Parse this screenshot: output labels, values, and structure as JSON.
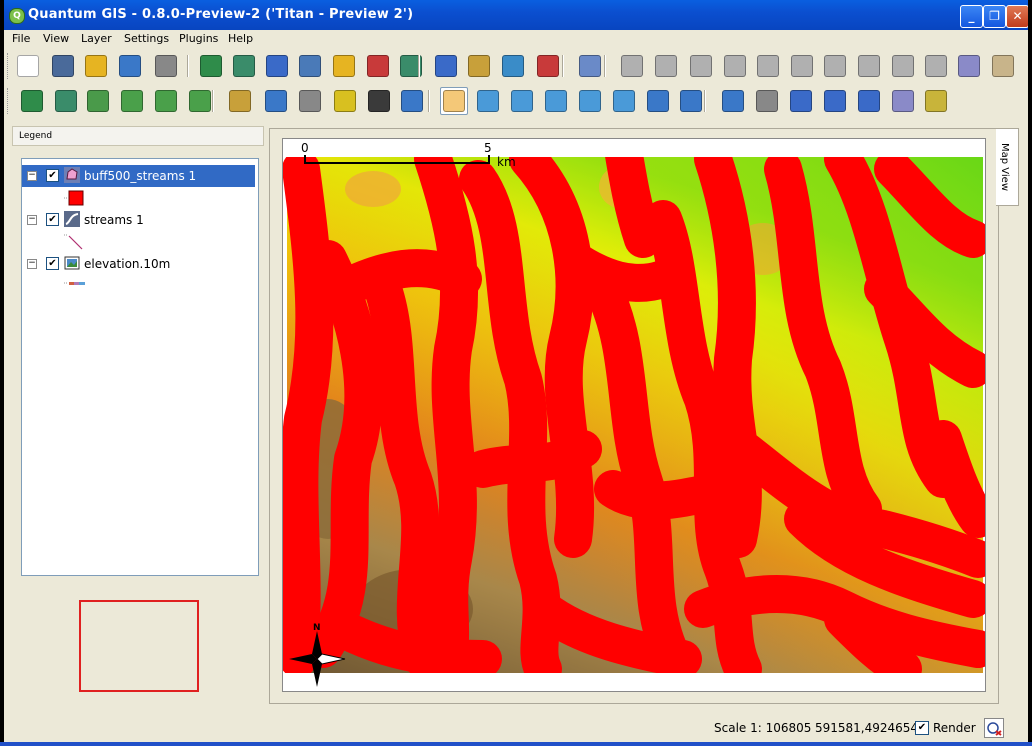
{
  "window": {
    "title": "Quantum GIS - 0.8.0-Preview-2 ('Titan - Preview 2')",
    "buttons": [
      "_",
      "❐",
      "✕"
    ]
  },
  "menu": [
    "File",
    "View",
    "Layer",
    "Settings",
    "Plugins",
    "Help"
  ],
  "toolbar1": {
    "tools": [
      {
        "name": "new-project-icon",
        "color": "#ffffff"
      },
      {
        "name": "save-project-icon",
        "color": "#4a6a9a"
      },
      {
        "name": "save-as-icon",
        "color": "#e6b422"
      },
      {
        "name": "open-project-icon",
        "color": "#3a78c8"
      },
      {
        "name": "print-icon",
        "color": "#888888"
      },
      {
        "name": "add-raster-icon",
        "color": "#2f8c4a"
      },
      {
        "name": "add-vector-icon",
        "color": "#3a8c6a"
      },
      {
        "name": "add-postgis-icon",
        "color": "#3a6ac8"
      },
      {
        "name": "add-wms-icon",
        "color": "#4a7ab8"
      },
      {
        "name": "new-vector-icon",
        "color": "#e6b422"
      },
      {
        "name": "add-layer-icon",
        "color": "#c83a3a"
      },
      {
        "name": "remove-layer-icon",
        "color": "#3a8c6a"
      },
      {
        "name": "show-all-icon",
        "color": "#3a6ac8"
      },
      {
        "name": "hide-all-icon",
        "color": "#c8a03a"
      },
      {
        "name": "zoom-to-layer-icon",
        "color": "#3a8cc8"
      },
      {
        "name": "overview-icon",
        "color": "#c83a3a"
      },
      {
        "name": "help-icon",
        "color": "#6a8ac8"
      },
      {
        "name": "capture-point-icon",
        "color": "#b0b0b0"
      },
      {
        "name": "capture-line-icon",
        "color": "#b0b0b0"
      },
      {
        "name": "capture-polygon-icon",
        "color": "#b0b0b0"
      },
      {
        "name": "add-vertex-icon",
        "color": "#b0b0b0"
      },
      {
        "name": "move-vertex-icon",
        "color": "#b0b0b0"
      },
      {
        "name": "delete-vertex-icon",
        "color": "#b0b0b0"
      },
      {
        "name": "add-ring-icon",
        "color": "#b0b0b0"
      },
      {
        "name": "add-island-icon",
        "color": "#b0b0b0"
      },
      {
        "name": "delete-feature-icon",
        "color": "#b0b0b0"
      },
      {
        "name": "cut-icon",
        "color": "#b0b0b0"
      },
      {
        "name": "copy-icon",
        "color": "#8a8ac8"
      },
      {
        "name": "paste-icon",
        "color": "#c8b48a"
      }
    ]
  },
  "toolbar2": {
    "tools": [
      {
        "name": "grass-open-mapset-icon",
        "color": "#2f8c4a"
      },
      {
        "name": "grass-new-mapset-icon",
        "color": "#3a8c6a"
      },
      {
        "name": "grass-close-mapset-icon",
        "color": "#4a9a4a"
      },
      {
        "name": "grass-add-vector-icon",
        "color": "#4aa04a"
      },
      {
        "name": "grass-add-raster-icon",
        "color": "#4aa04a"
      },
      {
        "name": "grass-edit-icon",
        "color": "#4aa04a"
      },
      {
        "name": "georeferencer-icon",
        "color": "#c8a03a"
      },
      {
        "name": "globe-icon",
        "color": "#3a78c8"
      },
      {
        "name": "gps-icon",
        "color": "#888888"
      },
      {
        "name": "graticule-icon",
        "color": "#d8c020"
      },
      {
        "name": "scalebar-icon",
        "color": "#3a3a3a"
      },
      {
        "name": "north-arrow-icon",
        "color": "#3a78c8"
      },
      {
        "name": "pan-icon",
        "color": "#f4c878"
      },
      {
        "name": "zoom-in-icon",
        "color": "#4a9ad8"
      },
      {
        "name": "zoom-out-icon",
        "color": "#4a9ad8"
      },
      {
        "name": "zoom-full-icon",
        "color": "#4a9ad8"
      },
      {
        "name": "zoom-selection-icon",
        "color": "#4a9ad8"
      },
      {
        "name": "zoom-layer-icon",
        "color": "#4a9ad8"
      },
      {
        "name": "zoom-last-icon",
        "color": "#3a78c8"
      },
      {
        "name": "refresh-icon",
        "color": "#3a78c8"
      },
      {
        "name": "identify-icon",
        "color": "#3a78c8"
      },
      {
        "name": "select-features-icon",
        "color": "#888888"
      },
      {
        "name": "attribute-table-icon",
        "color": "#3a6ac8"
      },
      {
        "name": "measure-line-icon",
        "color": "#3a6ac8"
      },
      {
        "name": "measure-area-icon",
        "color": "#3a6ac8"
      },
      {
        "name": "map-tips-icon",
        "color": "#8a8ac8"
      },
      {
        "name": "map-tips-2-icon",
        "color": "#c8b43a"
      }
    ]
  },
  "legend": {
    "title": "Legend",
    "layers": [
      {
        "name": "buff500_streams 1",
        "selected": true,
        "checked": "✔",
        "expander": "−"
      },
      {
        "name": "streams 1",
        "selected": false,
        "checked": "✔",
        "expander": "−"
      },
      {
        "name": "elevation.10m",
        "selected": false,
        "checked": "✔",
        "expander": "−"
      }
    ],
    "symbols": {
      "buffer_fill": "#ff0000",
      "stream_line": "#b03070"
    }
  },
  "map": {
    "tab_label": "Map View",
    "scalebar": {
      "start": "0",
      "end": "5",
      "unit": "km"
    },
    "north_label": "N",
    "colors": {
      "buffer": "#ff0000",
      "low": "#7a5a2a",
      "mid": "#e68c1c",
      "high": "#f4e400",
      "top": "#62d20a"
    }
  },
  "status": {
    "scale": "Scale 1: 106805",
    "coords": "591581,4924654",
    "render_checked": "✔",
    "render_label": "Render"
  }
}
